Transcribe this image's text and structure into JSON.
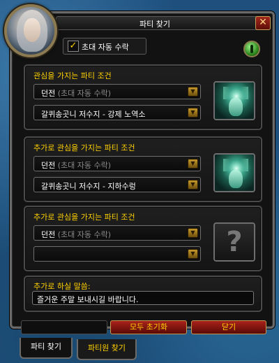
{
  "window": {
    "title": "파티 찾기",
    "close_label": "✕",
    "auto_accept_label": "초대 자동 수락",
    "auto_accept_checked": true
  },
  "panels": [
    {
      "title": "관심을 가지는 파티 조건",
      "dropdown1_main": "던전",
      "dropdown1_sub": "(초대 자동 수락)",
      "dropdown2": "갈퀴송곳니 저수지 - 강제 노역소",
      "icon": "boss-portrait-icon"
    },
    {
      "title": "추가로 관심을 가지는 파티 조건",
      "dropdown1_main": "던전",
      "dropdown1_sub": "(초대 자동 수락)",
      "dropdown2": "갈퀴송곳니 저수지 - 지하수렁",
      "icon": "boss-portrait-icon"
    },
    {
      "title": "추가로 관심을 가지는 파티 조건",
      "dropdown1_main": "던전",
      "dropdown1_sub": "(초대 자동 수락)",
      "dropdown2": "",
      "icon": "question-mark-icon"
    }
  ],
  "comment": {
    "label": "추가로 하실 말씀:",
    "value": "즐거운 주말 보내시길 바랍니다."
  },
  "buttons": {
    "reset": "모두 초기화",
    "close": "닫기"
  },
  "tabs": [
    {
      "label": "파티 찾기",
      "active": true
    },
    {
      "label": "파티원 찾기",
      "active": false
    }
  ],
  "colors": {
    "accent_gold": "#ffd100",
    "button_red": "#a9221a",
    "frame_gray": "#6a6a6a",
    "panel_dark": "#1f1f1f"
  }
}
